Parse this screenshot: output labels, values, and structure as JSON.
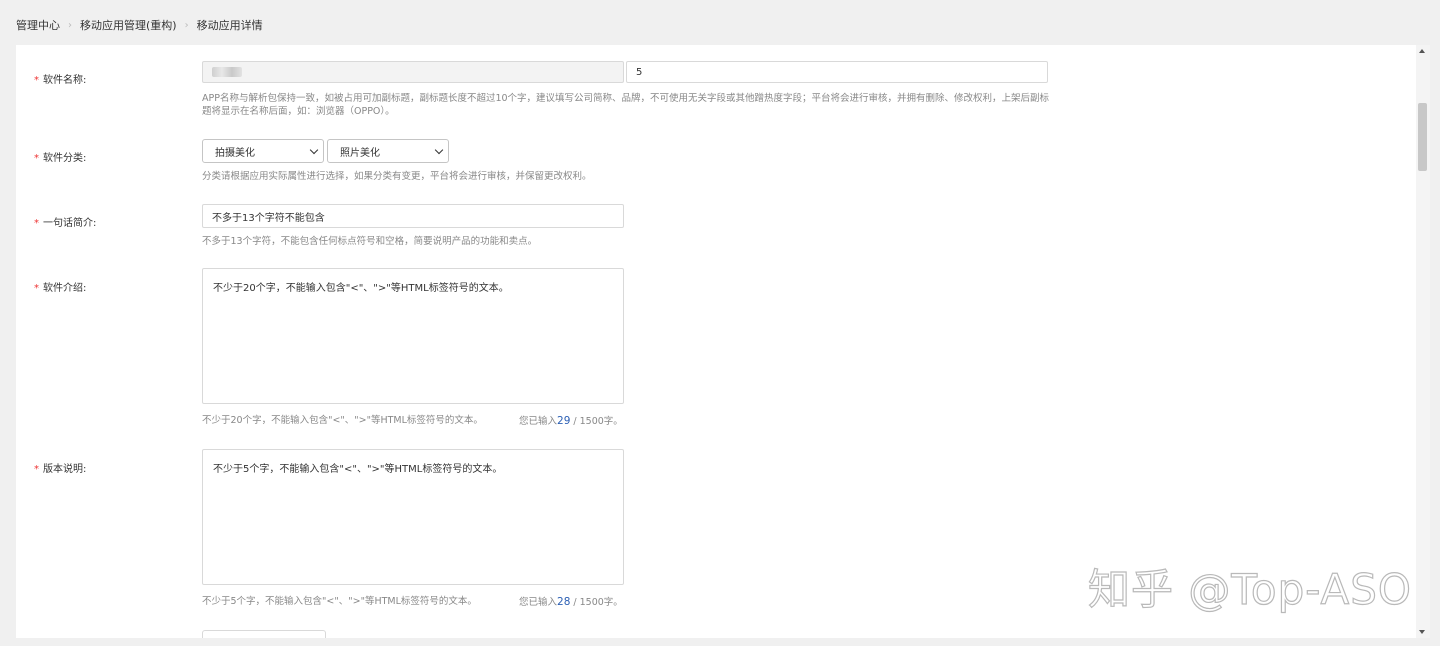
{
  "breadcrumb": {
    "items": [
      "管理中心",
      "移动应用管理(重构)",
      "移动应用详情"
    ],
    "separator": "›"
  },
  "form": {
    "required_mark": "*",
    "software_name": {
      "label": "软件名称:",
      "subtitle_value": "5",
      "hint": "APP名称与解析包保持一致，如被占用可加副标题，副标题长度不超过10个字，建议填写公司简称、品牌，不可使用无关字段或其他蹭热度字段；平台将会进行审核，并拥有删除、修改权利，上架后副标题将显示在名称后面，如：浏览器（OPPO）。"
    },
    "category": {
      "label": "软件分类:",
      "primary": "拍摄美化",
      "secondary": "照片美化",
      "hint": "分类请根据应用实际属性进行选择，如果分类有变更，平台将会进行审核，并保留更改权利。"
    },
    "one_line_intro": {
      "label": "一句话简介:",
      "value": "不多于13个字符不能包含",
      "hint": "不多于13个字符，不能包含任何标点符号和空格，简要说明产品的功能和卖点。"
    },
    "description": {
      "label": "软件介绍:",
      "value": "不少于20个字，不能输入包含\"<\"、\">\"等HTML标签符号的文本。",
      "hint": "不少于20个字，不能输入包含\"<\"、\">\"等HTML标签符号的文本。",
      "counter_prefix": "您已输入",
      "counter_value": "29",
      "counter_suffix": " / 1500字。"
    },
    "version_notes": {
      "label": "版本说明:",
      "value": "不少于5个字，不能输入包含\"<\"、\">\"等HTML标签符号的文本。",
      "hint": "不少于5个字，不能输入包含\"<\"、\">\"等HTML标签符号的文本。",
      "counter_prefix": "您已输入",
      "counter_value": "28",
      "counter_suffix": " / 1500字。"
    }
  },
  "watermark": "知乎 @Top-ASO",
  "colors": {
    "required": "#e33333",
    "counter_number": "#2b5fb4",
    "hint_text": "#888888"
  }
}
